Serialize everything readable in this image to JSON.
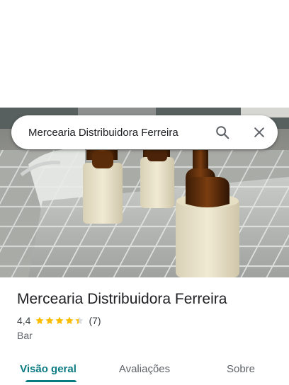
{
  "search": {
    "query": "Mercearia Distribuidora Ferreira",
    "search_icon": "search-icon",
    "close_icon": "close-icon"
  },
  "place": {
    "name": "Mercearia Distribuidora Ferreira",
    "rating": "4,4",
    "stars_value": 4.4,
    "review_count": "(7)",
    "category": "Bar"
  },
  "colors": {
    "accent": "#0b7b82",
    "star": "#fbbc04"
  },
  "tabs": [
    {
      "label": "Visão geral",
      "active": true
    },
    {
      "label": "Avaliações",
      "active": false
    },
    {
      "label": "Sobre",
      "active": false
    }
  ]
}
